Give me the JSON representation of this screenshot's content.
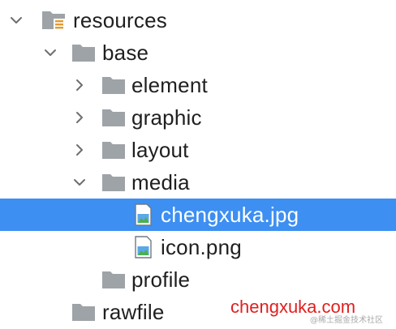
{
  "tree": {
    "resources": {
      "label": "resources",
      "icon": "resources-folder-icon",
      "state": "expanded"
    },
    "base": {
      "label": "base",
      "icon": "folder-icon",
      "state": "expanded"
    },
    "element": {
      "label": "element",
      "icon": "folder-icon",
      "state": "collapsed"
    },
    "graphic": {
      "label": "graphic",
      "icon": "folder-icon",
      "state": "collapsed"
    },
    "layout": {
      "label": "layout",
      "icon": "folder-icon",
      "state": "collapsed"
    },
    "media": {
      "label": "media",
      "icon": "folder-icon",
      "state": "expanded"
    },
    "chengxuka": {
      "label": "chengxuka.jpg",
      "icon": "image-file-icon",
      "selected": true
    },
    "icon_png": {
      "label": "icon.png",
      "icon": "image-file-icon",
      "selected": false
    },
    "profile": {
      "label": "profile",
      "icon": "folder-icon"
    },
    "rawfile": {
      "label": "rawfile",
      "icon": "folder-icon"
    }
  },
  "watermark": {
    "url": "chengxuka.com",
    "faint": "@稀土掘金技术社区"
  },
  "colors": {
    "selection": "#3d8ff1",
    "folder": "#9ea3a8",
    "chevron": "#6e6e6e",
    "watermark_red": "#e0201f"
  }
}
